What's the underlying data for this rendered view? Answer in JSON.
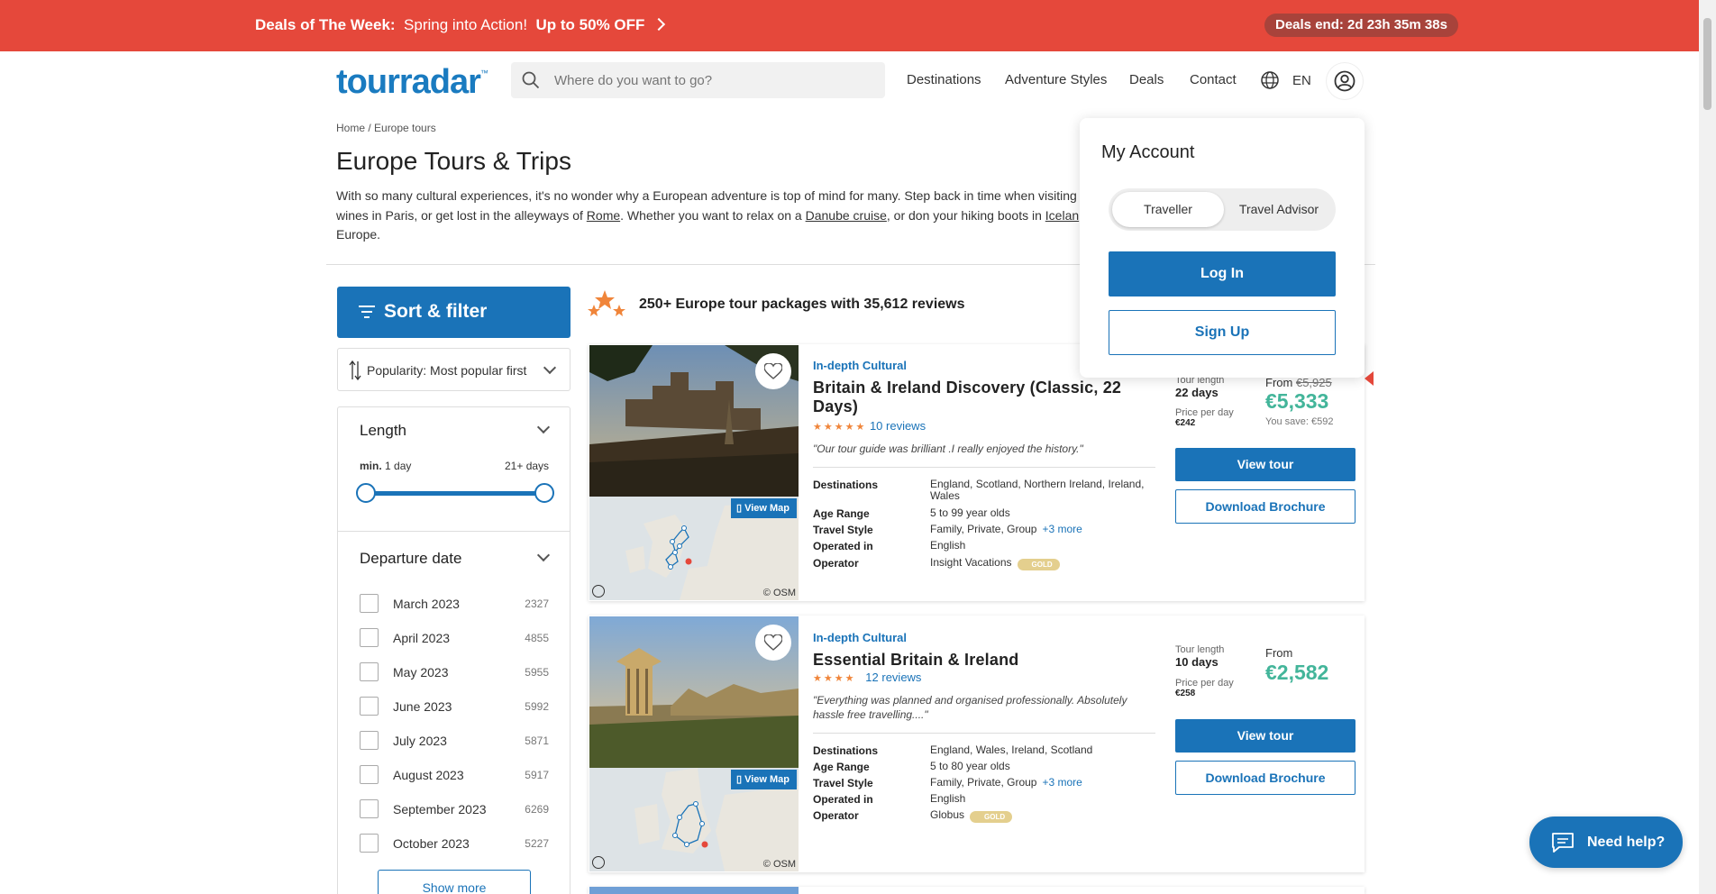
{
  "banner": {
    "deals_label": "Deals of The Week:",
    "deals_text": "Spring into Action!",
    "deals_offer": "Up to 50% OFF",
    "timer": "Deals end: 2d 23h 35m 38s"
  },
  "header": {
    "logo": "tourradar",
    "logo_tm": "™",
    "search_placeholder": "Where do you want to go?",
    "nav": [
      "Destinations",
      "Adventure Styles",
      "Deals",
      "Contact"
    ],
    "language": "EN"
  },
  "breadcrumb": "Home / Europe tours",
  "page_title": "Europe Tours & Trips",
  "intro": {
    "part1": "With so many cultural experiences, it's no wonder why a European adventure is top of mind for many. Step back in time when visiting",
    "part2": "wines in Paris, or get lost in the alleyways of ",
    "link_rome": "Rome",
    "part3": ". Whether you want to relax on a ",
    "link_danube": "Danube cruise",
    "part4": ", or don your hiking boots in ",
    "link_iceland": "Icelan",
    "part5": "Europe."
  },
  "sidebar": {
    "sort_filter_label": "Sort & filter",
    "sort_label": "Popularity: Most popular first",
    "length_title": "Length",
    "length_min_label": "min.",
    "length_min_value": "1 day",
    "length_max_value": "21+ days",
    "departure_title": "Departure date",
    "months": [
      {
        "name": "March 2023",
        "count": "2327"
      },
      {
        "name": "April 2023",
        "count": "4855"
      },
      {
        "name": "May 2023",
        "count": "5955"
      },
      {
        "name": "June 2023",
        "count": "5992"
      },
      {
        "name": "July 2023",
        "count": "5871"
      },
      {
        "name": "August 2023",
        "count": "5917"
      },
      {
        "name": "September 2023",
        "count": "6269"
      },
      {
        "name": "October 2023",
        "count": "5227"
      }
    ],
    "show_more": "Show more"
  },
  "results": {
    "count_text": "250+ Europe tour packages with 35,612 reviews"
  },
  "tours": [
    {
      "category": "In-depth Cultural",
      "title": "Britain & Ireland Discovery (Classic, 22 Days)",
      "stars": "★★★★★",
      "reviews": "10 reviews",
      "quote": "\"Our tour guide was brilliant .I really enjoyed the history.\"",
      "view_map": "View Map",
      "map_credit": "© OSM",
      "specs": {
        "destinations_key": "Destinations",
        "destinations": "England, Scotland, Northern Ireland, Ireland, Wales",
        "age_key": "Age Range",
        "age": "5 to 99 year olds",
        "style_key": "Travel Style",
        "style": "Family, Private, Group",
        "style_more": "+3 more",
        "operated_key": "Operated in",
        "operated": "English",
        "operator_key": "Operator",
        "operator": "Insight Vacations",
        "badge": "GOLD"
      },
      "length_label": "Tour length",
      "length": "22 days",
      "ppd_label": "Price per day",
      "ppd": "€242",
      "from_label": "From",
      "old_price": "€5,925",
      "price": "€5,333",
      "save": "You save: €592",
      "view_tour": "View tour",
      "brochure": "Download Brochure"
    },
    {
      "category": "In-depth Cultural",
      "title": "Essential Britain & Ireland",
      "stars": "★★★★",
      "reviews": "12 reviews",
      "quote": "\"Everything was planned and organised professionally. Absolutely hassle free travelling....\"",
      "view_map": "View Map",
      "map_credit": "© OSM",
      "specs": {
        "destinations_key": "Destinations",
        "destinations": "England, Wales, Ireland, Scotland",
        "age_key": "Age Range",
        "age": "5 to 80 year olds",
        "style_key": "Travel Style",
        "style": "Family, Private, Group",
        "style_more": "+3 more",
        "operated_key": "Operated in",
        "operated": "English",
        "operator_key": "Operator",
        "operator": "Globus",
        "badge": "GOLD"
      },
      "length_label": "Tour length",
      "length": "10 days",
      "ppd_label": "Price per day",
      "ppd": "€258",
      "from_label": "From",
      "price": "€2,582",
      "view_tour": "View tour",
      "brochure": "Download Brochure"
    }
  ],
  "account_menu": {
    "title": "My Account",
    "option_traveller": "Traveller",
    "option_advisor": "Travel Advisor",
    "login": "Log In",
    "signup": "Sign Up"
  },
  "help": {
    "label": "Need help?"
  },
  "colors": {
    "brand": "#1a73b8",
    "banner": "#e5483b",
    "price": "#43b59a",
    "stars": "#f0853a"
  }
}
